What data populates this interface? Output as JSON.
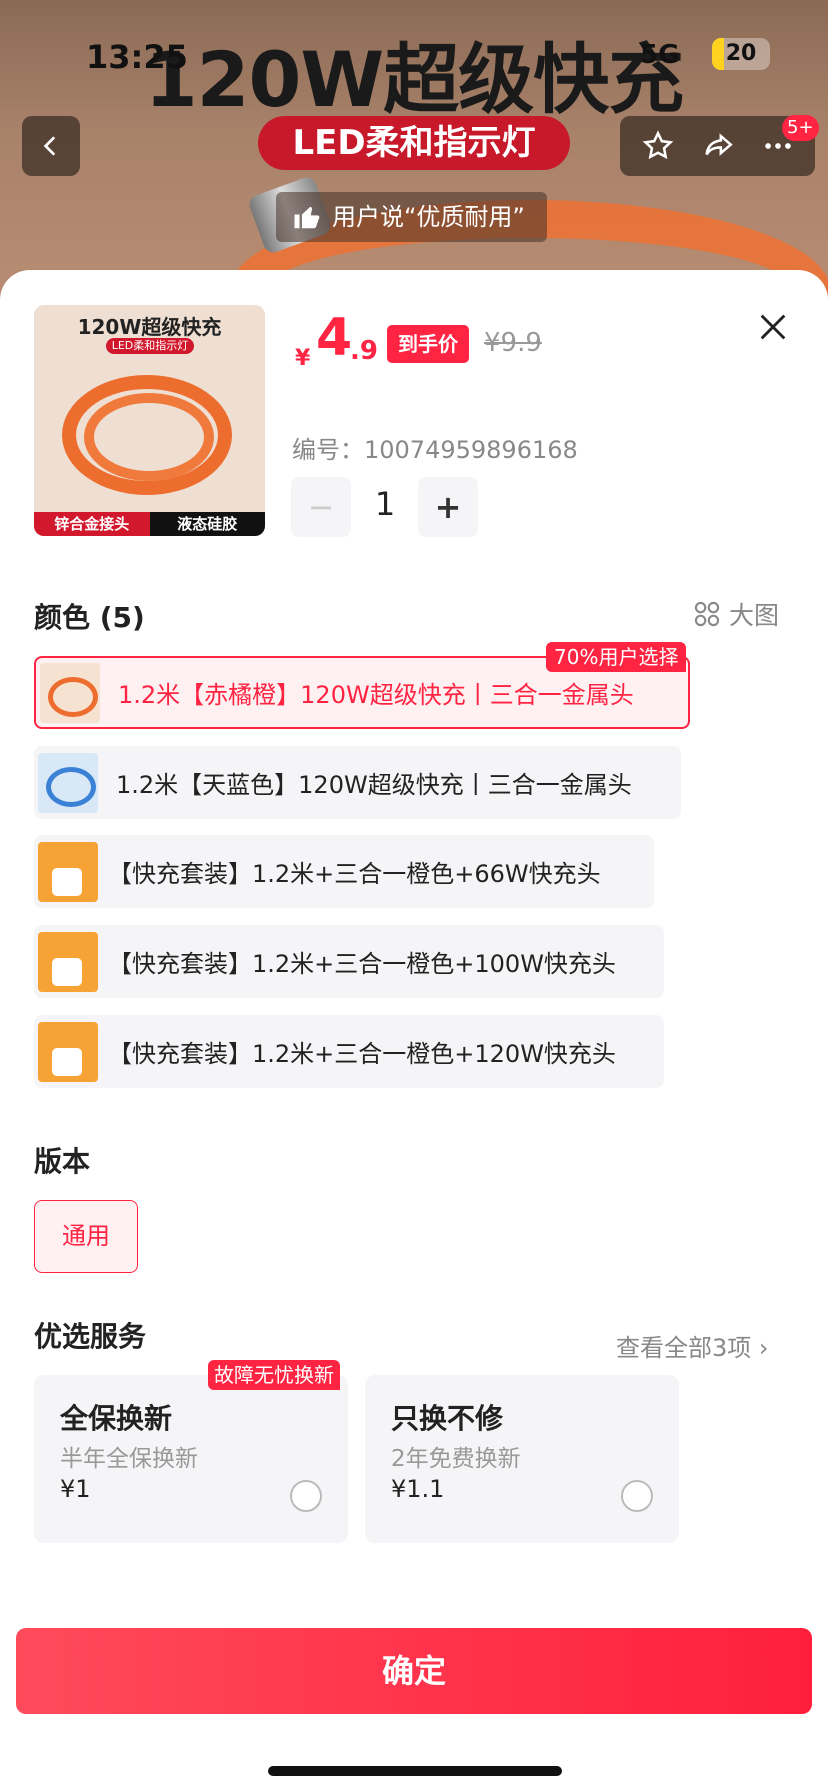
{
  "banner": {
    "title": "120W超级快充",
    "tag": "LED柔和指示灯",
    "quote": "用户说“优质耐用”"
  },
  "status_bar": {
    "time": "13:25",
    "network": "5G",
    "battery": "20"
  },
  "nav": {
    "badge": "5+"
  },
  "product": {
    "image": {
      "title": "120W超级快充",
      "tag": "LED柔和指示灯",
      "left_label": "锌合金接头",
      "right_label": "液态硅胶"
    },
    "price_currency": "¥",
    "price_int": "4",
    "price_dec": ".9",
    "price_tag": "到手价",
    "old_price": "¥9.9",
    "sku_number": "编号：10074959896168",
    "quantity": "1",
    "minus": "−",
    "plus": "+"
  },
  "color_section": {
    "title": "颜色 (5)",
    "big_image": "大图",
    "selected_badge": "70%用户选择",
    "options": [
      {
        "label": "1.2米【赤橘橙】120W超级快充丨三合一金属头"
      },
      {
        "label": "1.2米【天蓝色】120W超级快充丨三合一金属头"
      },
      {
        "label": "【快充套装】1.2米+三合一橙色+66W快充头"
      },
      {
        "label": "【快充套装】1.2米+三合一橙色+100W快充头"
      },
      {
        "label": "【快充套装】1.2米+三合一橙色+120W快充头"
      }
    ]
  },
  "version_section": {
    "title": "版本",
    "option": "通用"
  },
  "service_section": {
    "title": "优选服务",
    "see_all": "查看全部3项 ›",
    "badge": "故障无忧换新",
    "services": [
      {
        "title": "全保换新",
        "subtitle": "半年全保换新",
        "price": "¥1"
      },
      {
        "title": "只换不修",
        "subtitle": "2年免费换新",
        "price": "¥1.1"
      }
    ]
  },
  "confirm_button": "确定",
  "colors": {
    "accent": "#ff2442"
  }
}
